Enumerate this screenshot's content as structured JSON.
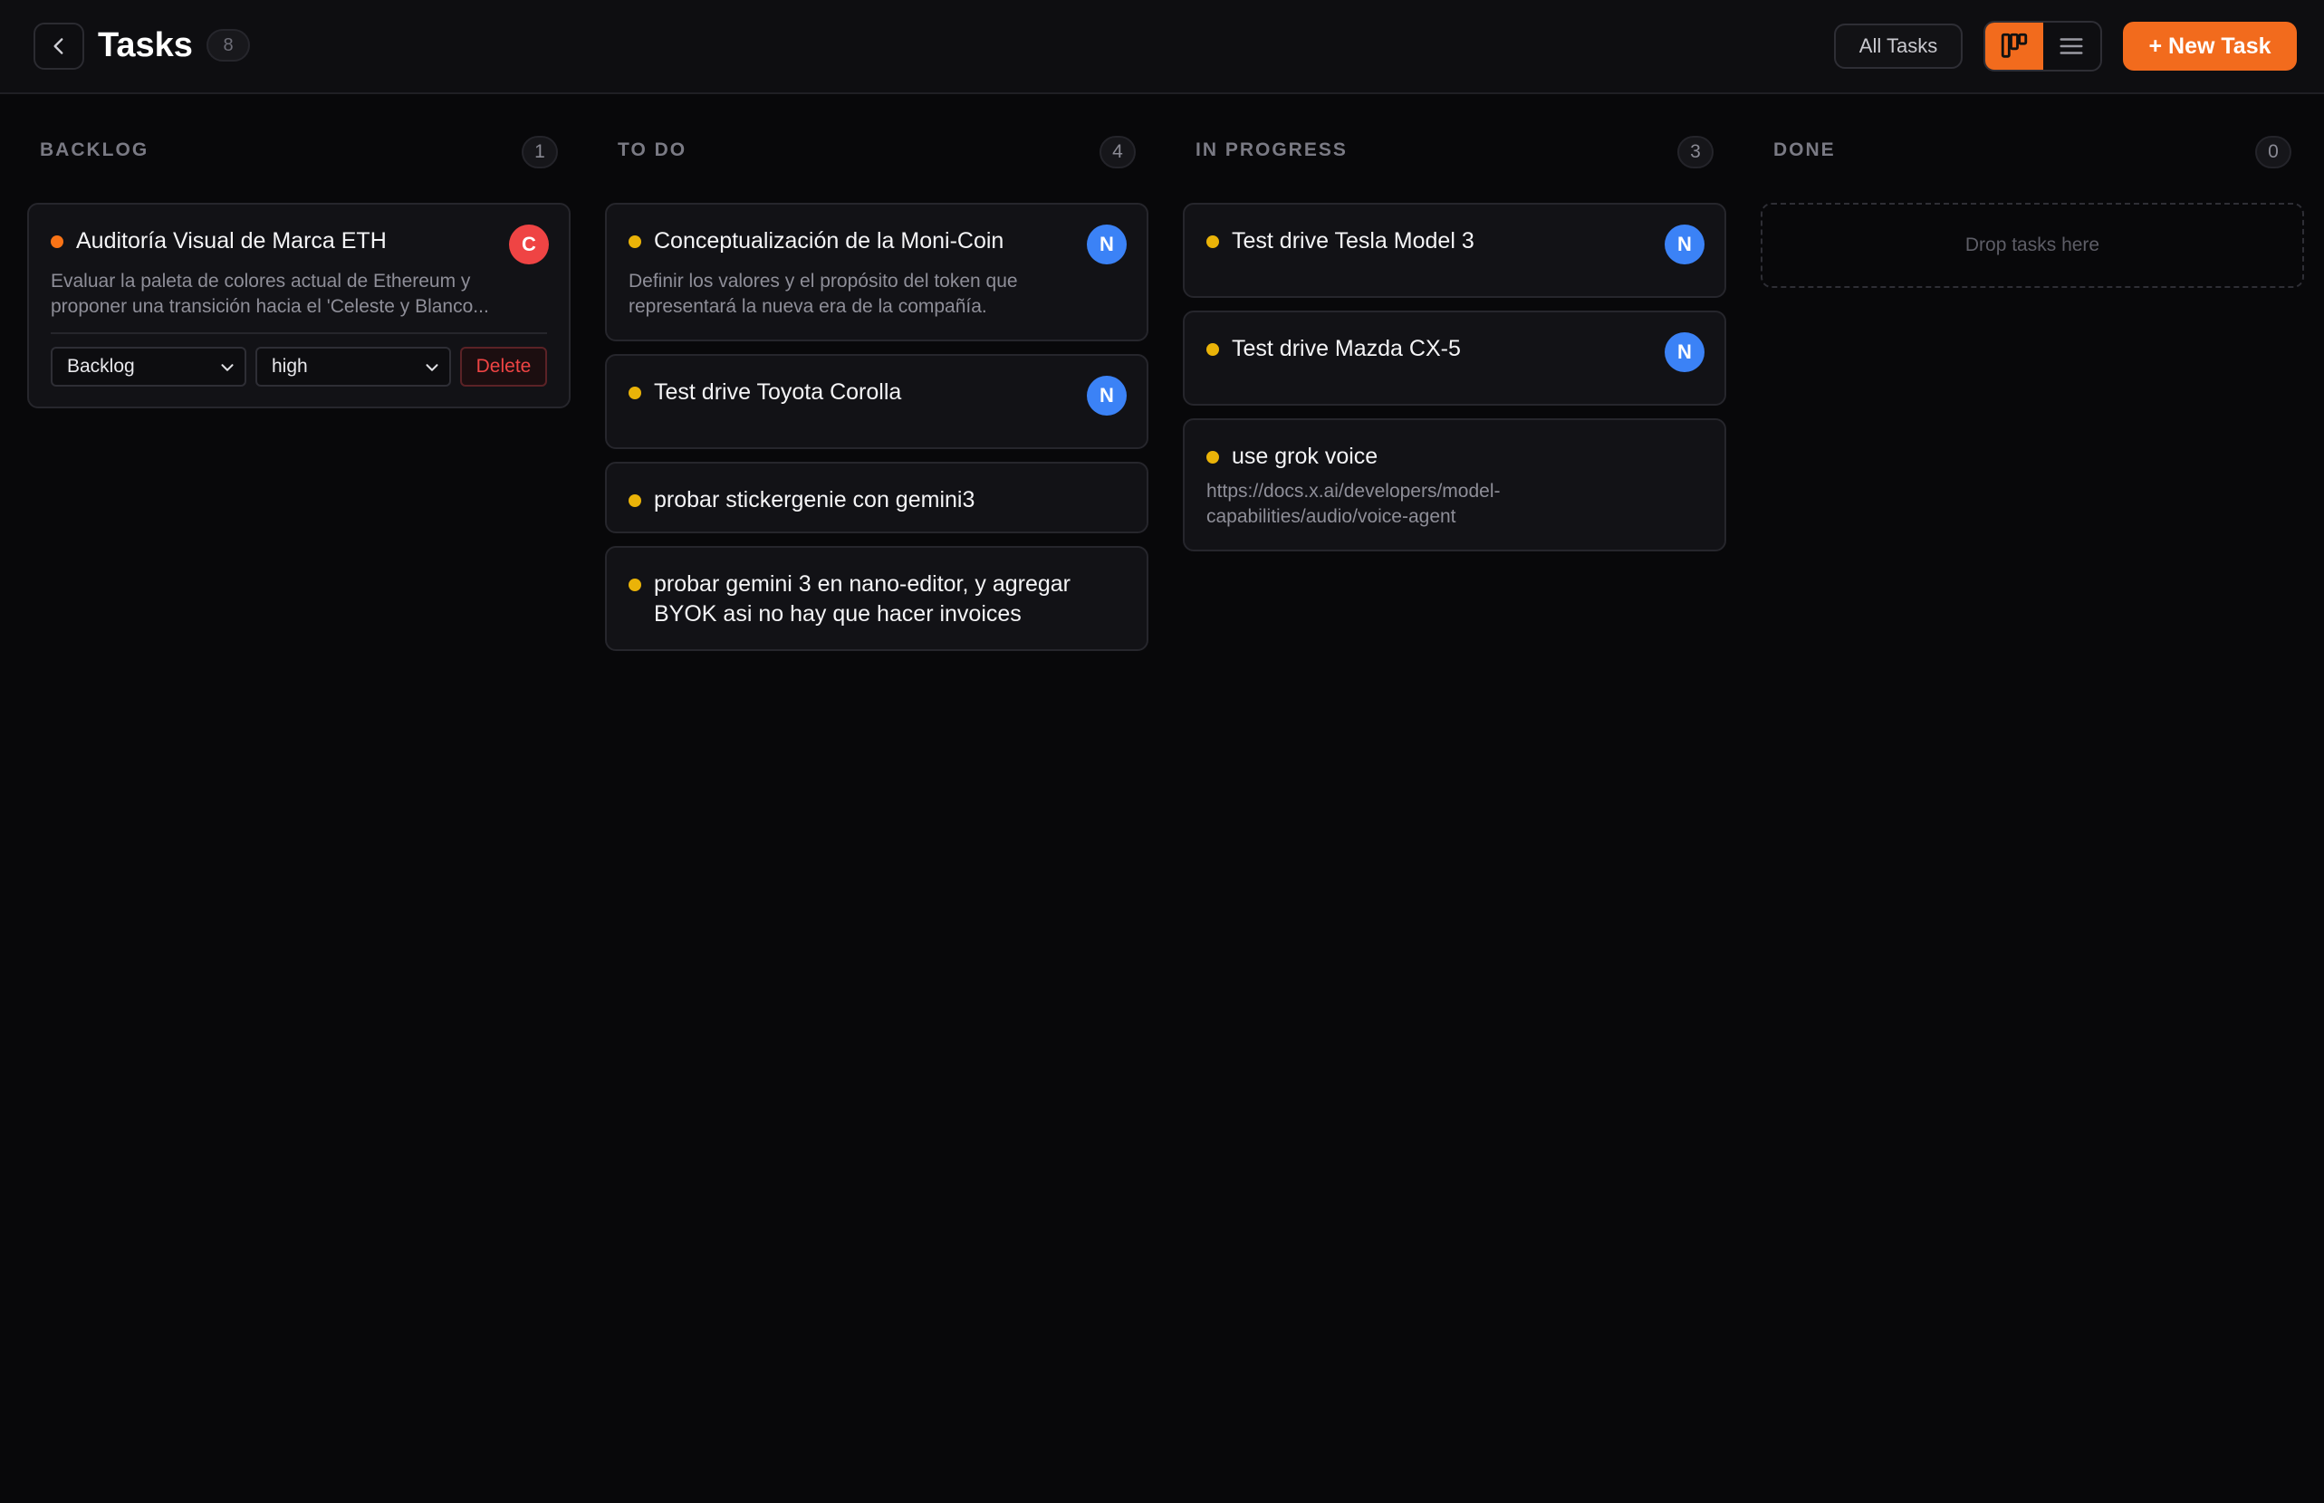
{
  "header": {
    "title": "Tasks",
    "count": "8",
    "all_tasks_label": "All Tasks",
    "new_task_label": "+ New Task"
  },
  "colors": {
    "accent": "#f26b1d",
    "avatar_blue": "#3b82f6",
    "avatar_red": "#ef4444",
    "priority_orange": "#f97316",
    "priority_yellow": "#eab308"
  },
  "icons": {
    "back": "chevron-left-icon",
    "board_view": "kanban-icon",
    "list_view": "list-icon",
    "dropdown": "chevron-down-icon"
  },
  "columns": [
    {
      "title": "BACKLOG",
      "count": "1",
      "cards": [
        {
          "title": "Auditoría Visual de Marca ETH",
          "avatar": "C",
          "description_line1": "Evaluar la paleta de colores actual de Ethereum y",
          "description_line2": "proponer una transición hacia el 'Celeste y Blanco...",
          "status_value": "Backlog",
          "priority_value": "high",
          "delete_label": "Delete"
        }
      ]
    },
    {
      "title": "TO DO",
      "count": "4",
      "cards": [
        {
          "title": "Conceptualización de la Moni-Coin",
          "avatar": "N",
          "description_line1": "Definir los valores y el propósito del token que",
          "description_line2": "representará la nueva era de la compañía."
        },
        {
          "title": "Test drive Toyota Corolla",
          "avatar": "N"
        },
        {
          "title": "probar stickergenie con gemini3"
        },
        {
          "title_line1": "probar gemini 3 en nano-editor, y agregar",
          "title_line2": "BYOK asi no hay que hacer invoices"
        }
      ]
    },
    {
      "title": "IN PROGRESS",
      "count": "3",
      "cards": [
        {
          "title": "Test drive Tesla Model 3",
          "avatar": "N"
        },
        {
          "title": "Test drive Mazda CX-5",
          "avatar": "N"
        },
        {
          "title": "use grok voice",
          "description_line1": "https://docs.x.ai/developers/model-",
          "description_line2": "capabilities/audio/voice-agent"
        }
      ]
    },
    {
      "title": "DONE",
      "count": "0",
      "drop_text": "Drop tasks here"
    }
  ]
}
